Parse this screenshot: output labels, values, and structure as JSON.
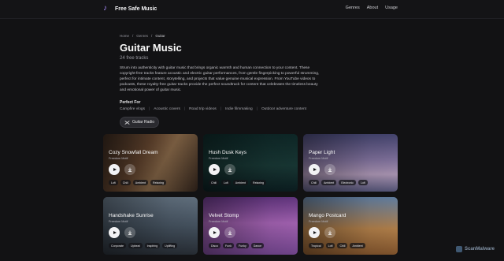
{
  "nav": {
    "brand": "Free Safe Music",
    "links": [
      "Genres",
      "About",
      "Usage"
    ]
  },
  "breadcrumb": [
    "Home",
    "Genres",
    "Guitar"
  ],
  "page": {
    "title": "Guitar Music",
    "count": "24 free tracks",
    "description": "Strum into authenticity with guitar music that brings organic warmth and human connection to your content. These copyright-free tracks feature acoustic and electric guitar performances, from gentle fingerpicking to powerful strumming, perfect for intimate content, storytelling, and projects that value genuine musical expression. From YouTube videos to podcasts, these royalty-free guitar tracks provide the perfect soundtrack for content that celebrates the timeless beauty and emotional power of guitar music.",
    "perfect_for_label": "Perfect For",
    "perfect_for": [
      "Campfire vlogs",
      "Acoustic covers",
      "Road trip videos",
      "Indie filmmaking",
      "Outdoor adventure content"
    ],
    "radio_button": "Guitar Radio"
  },
  "tracks": [
    {
      "name": "Cozy Snowfall Dream",
      "artist": "Freedom Motif",
      "tags": [
        "Lofi",
        "Chill",
        "Ambient",
        "Relaxing"
      ]
    },
    {
      "name": "Hush Dusk Keys",
      "artist": "Freedom Motif",
      "tags": [
        "Chill",
        "Lofi",
        "Ambient",
        "Relaxing"
      ]
    },
    {
      "name": "Paper Light",
      "artist": "Freedom Motif",
      "tags": [
        "Chill",
        "Ambient",
        "Electronic",
        "Lofi"
      ]
    },
    {
      "name": "Handshake Sunrise",
      "artist": "Freedom Motif",
      "tags": [
        "Corporate",
        "Upbeat",
        "Inspiring",
        "Uplifting"
      ]
    },
    {
      "name": "Velvet Stomp",
      "artist": "Freedom Motif",
      "tags": [
        "Disco",
        "Funk",
        "Funky",
        "Dance"
      ]
    },
    {
      "name": "Mango Postcard",
      "artist": "Freedom Motif",
      "tags": [
        "Tropical",
        "Lofi",
        "Chill",
        "Ambient"
      ]
    }
  ],
  "watermark": "ScanMalware",
  "icons": {
    "logo": "music-note-icon",
    "radio": "shuffle-icon",
    "play": "play-icon",
    "download": "download-icon"
  },
  "colors": {
    "accent": "#a78bfa",
    "background": "#121214"
  }
}
